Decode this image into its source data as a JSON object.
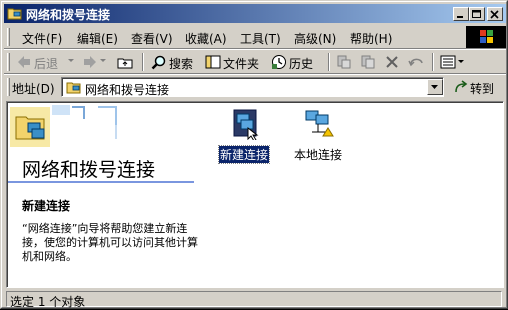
{
  "window": {
    "title": "网络和拨号连接",
    "icon": "network-folder-icon"
  },
  "menu": {
    "items": [
      {
        "label": "文件(F)"
      },
      {
        "label": "编辑(E)"
      },
      {
        "label": "查看(V)"
      },
      {
        "label": "收藏(A)"
      },
      {
        "label": "工具(T)"
      },
      {
        "label": "高级(N)"
      },
      {
        "label": "帮助(H)"
      }
    ]
  },
  "toolbar": {
    "back_label": "后退",
    "search_label": "搜索",
    "folders_label": "文件夹",
    "history_label": "历史"
  },
  "address": {
    "label": "地址(D)",
    "value": "网络和拨号连接",
    "go_label": "转到"
  },
  "content": {
    "folder_title": "网络和拨号连接",
    "selected_title": "新建连接",
    "description": "“网络连接”向导将帮助您建立新连接，使您的计算机可以访问其他计算机和网络。",
    "items": [
      {
        "label": "新建连接",
        "icon": "new-connection-icon",
        "selected": true
      },
      {
        "label": "本地连接",
        "icon": "local-area-connection-icon",
        "selected": false
      }
    ]
  },
  "status": {
    "text": "选定 1 个对象"
  },
  "colors": {
    "titlebar_start": "#0a246a",
    "titlebar_end": "#a6caf0",
    "face": "#d4d0c8",
    "selection": "#0a246a"
  }
}
